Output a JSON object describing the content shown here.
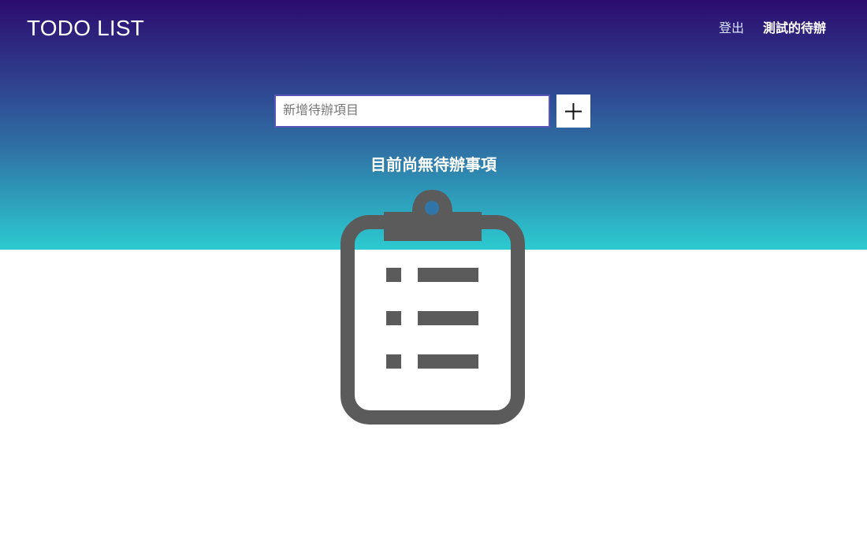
{
  "app": {
    "title": "TODO LIST"
  },
  "header": {
    "logout_label": "登出",
    "user_label": "測試的待辦"
  },
  "composer": {
    "placeholder": "新增待辦項目",
    "add_icon": "plus-icon"
  },
  "empty_state": {
    "message": "目前尚無待辦事項",
    "icon": "clipboard-list-icon"
  },
  "colors": {
    "gradient_top": "#2c0c6f",
    "gradient_bottom": "#2ccbd0",
    "icon_gray": "#5b5b5b",
    "input_border": "#5a56b8"
  }
}
